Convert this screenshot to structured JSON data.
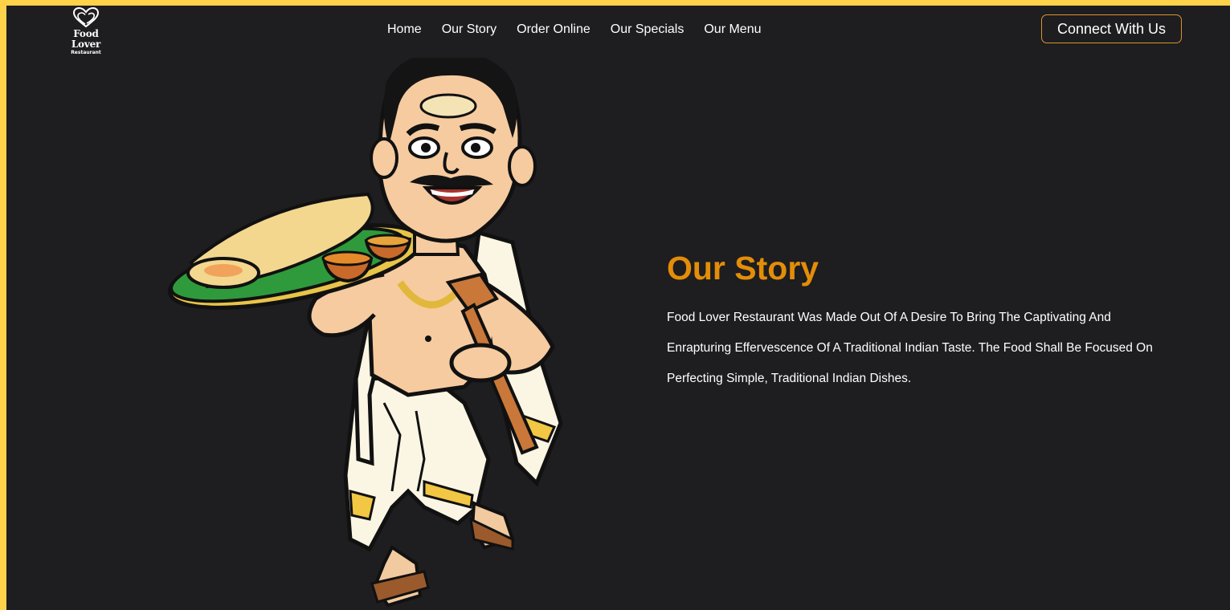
{
  "brand": {
    "name": "Food Lover",
    "tagline": "Restaurant",
    "logo_icon": "heart-logo-icon"
  },
  "nav": {
    "items": [
      {
        "label": "Home"
      },
      {
        "label": "Our Story"
      },
      {
        "label": "Order Online"
      },
      {
        "label": "Our Specials"
      },
      {
        "label": "Our Menu"
      }
    ],
    "cta_label": "Connect With Us"
  },
  "story": {
    "title": "Our Story",
    "body": "Food Lover Restaurant Was Made Out Of A Desire To Bring The Captivating And Enrapturing Effervescence Of A Traditional Indian Taste. The Food Shall Be Focused On Perfecting Simple, Traditional Indian Dishes."
  },
  "hero": {
    "image_subject": "chef-illustration"
  },
  "colors": {
    "frame": "#ffd24a",
    "background": "#1e1d20",
    "accent": "#e38d09",
    "button_border": "#d9962b",
    "text": "#ffffff"
  }
}
